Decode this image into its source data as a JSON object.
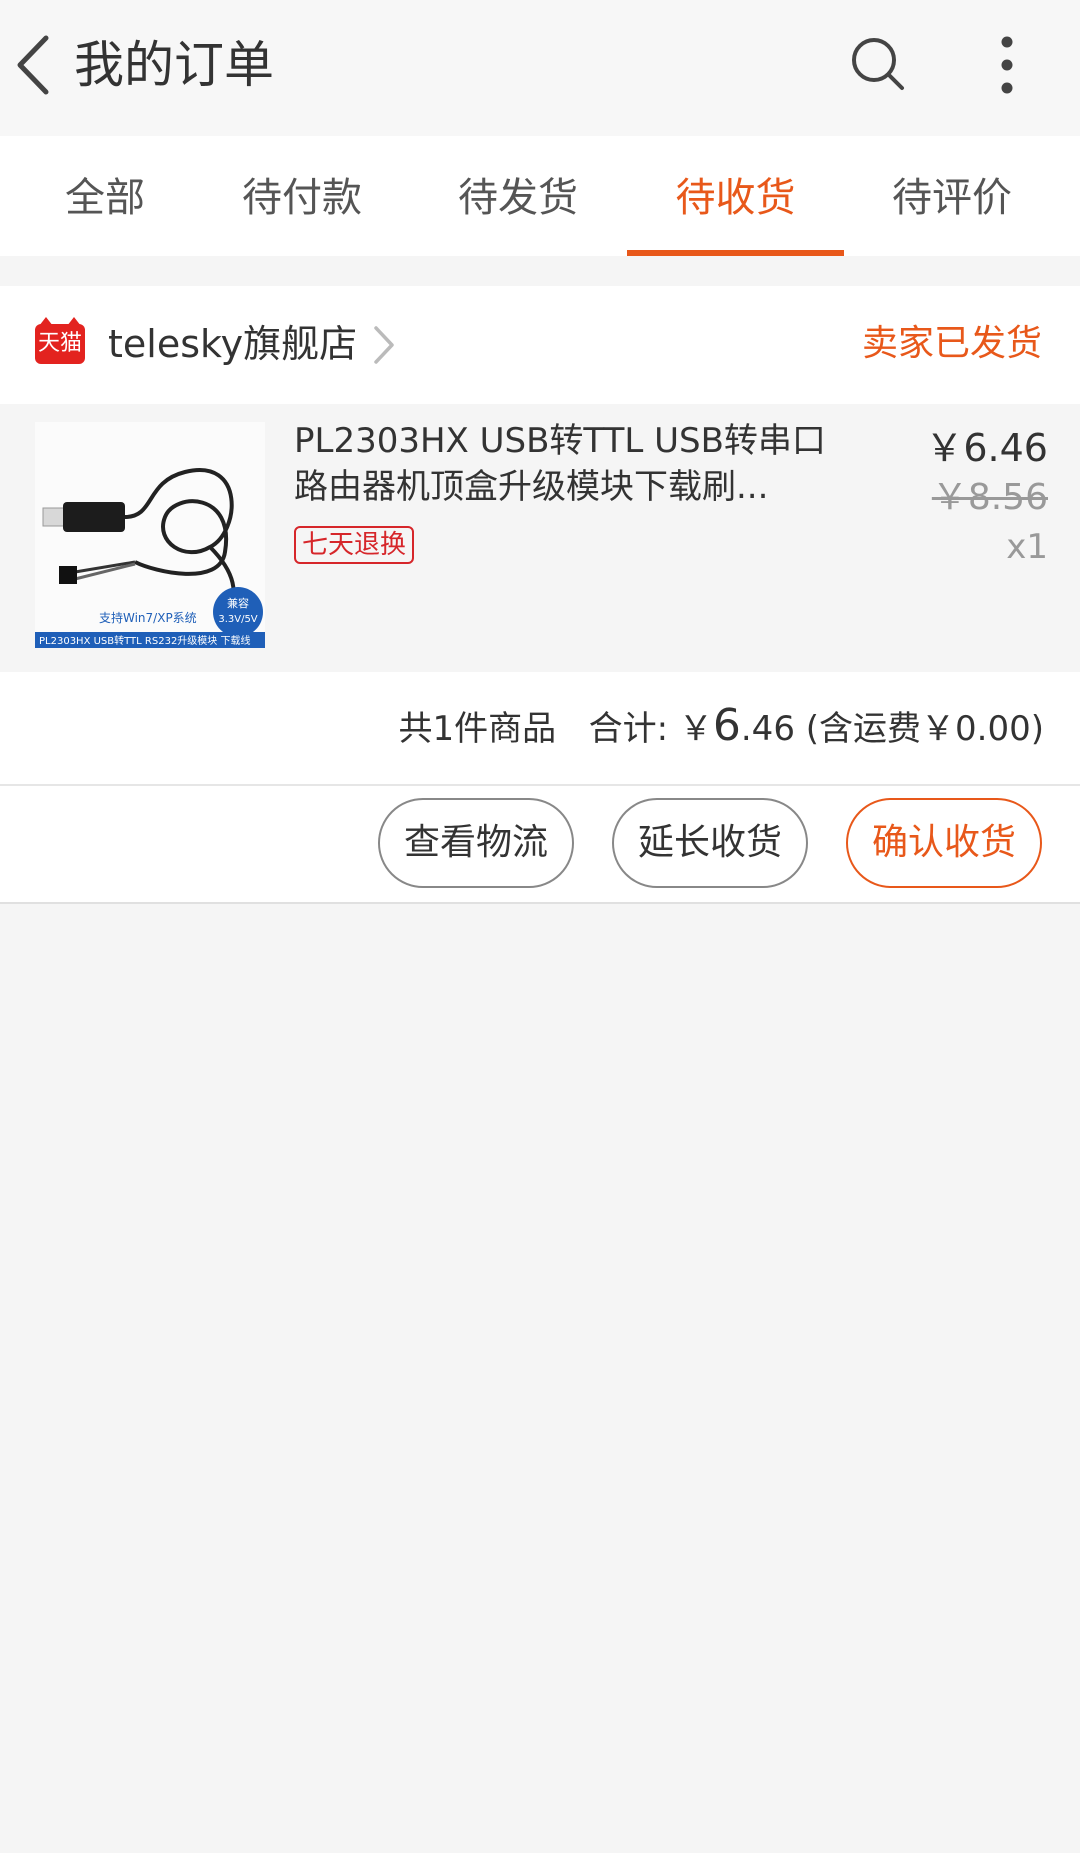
{
  "header": {
    "title": "我的订单",
    "back_icon": "chevron-left-icon",
    "search_icon": "search-icon",
    "more_icon": "more-vertical-icon"
  },
  "tabs": [
    {
      "label": "全部"
    },
    {
      "label": "待付款"
    },
    {
      "label": "待发货"
    },
    {
      "label": "待收货",
      "active": true
    },
    {
      "label": "待评价"
    }
  ],
  "order": {
    "store": {
      "badge": "天猫",
      "name": "telesky旗舰店",
      "status": "卖家已发货"
    },
    "item": {
      "title": "PL2303HX USB转TTL USB转串口 路由器机顶盒升级模块下载刷...",
      "badge": "七天退换",
      "price": "￥6.46",
      "original_price": "￥8.56",
      "quantity": "x1",
      "image_text": {
        "compat_label": "兼容",
        "compat_voltage": "3.3V/5V",
        "support": "支持Win7/XP系统",
        "caption": "PL2303HX USB转TTL RS232升级模块 下载线"
      }
    },
    "summary": {
      "count": "共1件商品",
      "total_label": "合计:",
      "currency": "￥",
      "total_int": "6",
      "total_dec": ".46",
      "shipping": "(含运费￥0.00)"
    },
    "actions": {
      "logistics": "查看物流",
      "extend": "延长收货",
      "confirm": "确认收货"
    }
  },
  "colors": {
    "accent": "#e8581a",
    "tmall_red": "#e3231f",
    "badge_red": "#d6262a"
  }
}
